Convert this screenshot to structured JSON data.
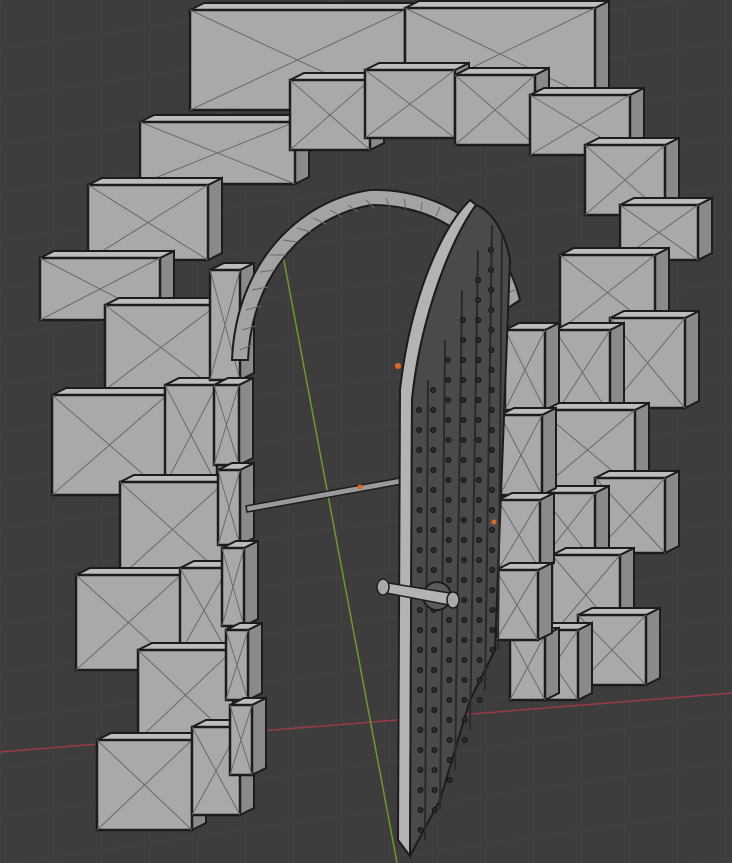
{
  "viewport": {
    "background": "#3d3d3d",
    "grid_color": "#474747",
    "x_axis_color": "#9a3a46",
    "y_axis_color": "#6f9a2a",
    "origin_color": "#e5661e"
  },
  "model": {
    "stone_face": "#a9a9a9",
    "stone_side": "#8a8a8a",
    "stone_top": "#bdbdbd",
    "edge": "#1c1c1c",
    "wire": "#6a6a6a",
    "door_plank": "#4a4a4a",
    "door_frame": "#b3b3b3",
    "rivet": "#2a2a2a"
  }
}
